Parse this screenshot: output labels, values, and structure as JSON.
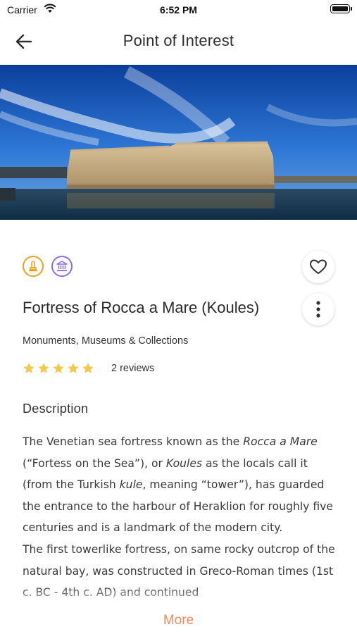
{
  "status_bar": {
    "carrier": "Carrier",
    "time": "6:52 PM"
  },
  "nav": {
    "title": "Point of Interest",
    "back_icon": "arrow-left-icon"
  },
  "hero_image": {
    "description_icon": "fortress-photo"
  },
  "category_icons": [
    {
      "name": "monument-icon",
      "color": "#f0a020"
    },
    {
      "name": "museum-icon",
      "color": "#8a6ee8"
    }
  ],
  "poi": {
    "title": "Fortress of Rocca a Mare (Koules)",
    "category": "Monuments, Museums & Collections",
    "rating": 5,
    "rating_max": 5,
    "reviews": "2 reviews"
  },
  "description": {
    "heading": "Description",
    "p1_a": "The Venetian sea fortress known as the ",
    "p1_b": "Rocca a Mare",
    "p1_c": " (“Fortess on the Sea”), or ",
    "p1_d": "Koules",
    "p1_e": " as the locals call it (from the Turkish ",
    "p1_f": "kule",
    "p1_g": ", meaning “tower”), has guarded the entrance to the harbour of Heraklion for roughly five centuries and is a landmark of the modern city.",
    "p2": "The first towerlike fortress, on same rocky outcrop of the natural bay, was constructed in Greco-Roman times (1st c. BC - 4th c. AD) and continued"
  },
  "more_label": "More",
  "colors": {
    "accent": "#f08a5d",
    "star": "#f2c94c"
  }
}
